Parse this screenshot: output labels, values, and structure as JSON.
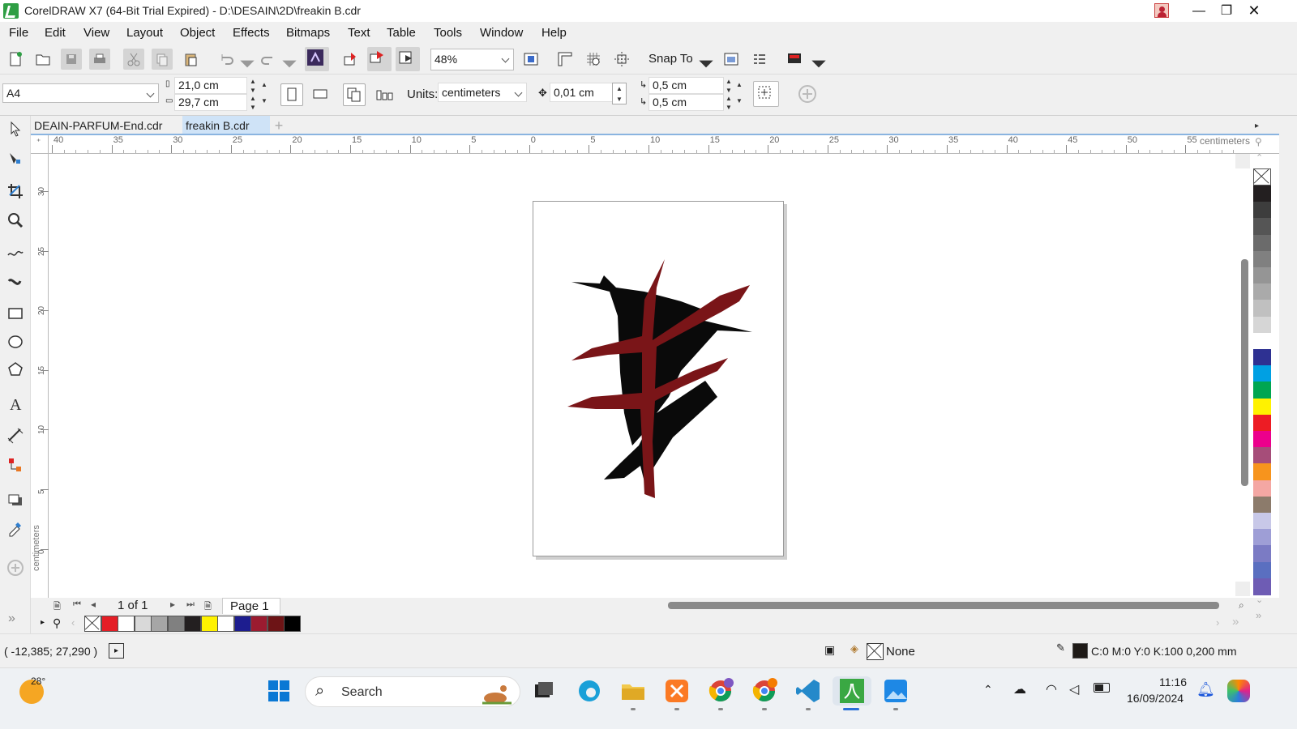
{
  "window": {
    "title": "CorelDRAW X7 (64-Bit Trial Expired) - D:\\DESAIN\\2D\\freakin B.cdr",
    "minimize": "—",
    "maximize": "❐",
    "close": "✕"
  },
  "menu": [
    "File",
    "Edit",
    "View",
    "Layout",
    "Object",
    "Effects",
    "Bitmaps",
    "Text",
    "Table",
    "Tools",
    "Window",
    "Help"
  ],
  "toolbar": {
    "zoom": "48%",
    "snap_to": "Snap To"
  },
  "property_bar": {
    "page_size": "A4",
    "width": "21,0 cm",
    "height": "29,7 cm",
    "units_label": "Units:",
    "units": "centimeters",
    "nudge": "0,01 cm",
    "dup_x": "0,5 cm",
    "dup_y": "0,5 cm"
  },
  "tabs": [
    "DEAIN-PARFUM-End.cdr",
    "freakin B.cdr"
  ],
  "ruler": {
    "h_ticks": [
      "40",
      "35",
      "30",
      "25",
      "20",
      "15",
      "10",
      "5",
      "0",
      "5",
      "10",
      "15",
      "20",
      "25",
      "30",
      "35",
      "40",
      "45",
      "50",
      "55"
    ],
    "h_unit": "centimeters",
    "v_ticks": [
      "30",
      "25",
      "20",
      "15",
      "10",
      "5",
      "0"
    ],
    "v_unit": "centimeters"
  },
  "page_nav": {
    "count": "1 of 1",
    "page_tab": "Page 1"
  },
  "palette_bottom": [
    "none",
    "#e41e26",
    "#ffffff",
    "#d9d9d9",
    "#a6a6a6",
    "#808080",
    "#231f20",
    "#fff200",
    "#ffffff",
    "#1d1d8f",
    "#9b1b30",
    "#6d1416",
    "#000000"
  ],
  "palette_right": [
    "#231f20",
    "#3d3d3d",
    "#555555",
    "#6b6b6b",
    "#808080",
    "#959595",
    "#aaaaaa",
    "#c0c0c0",
    "#d6d6d6",
    "#ffffff",
    "#2e3192",
    "#00a0e3",
    "#00a651",
    "#fff200",
    "#ed1c24",
    "#ec008c",
    "#a64d79",
    "#f7941d",
    "#f4a7a3",
    "#8c7b6b",
    "#c8c8e8",
    "#9e9ed6",
    "#7b7bc4",
    "#5a6fc0",
    "#6e5cb4"
  ],
  "status": {
    "coords": "( -12,385; 27,290 )",
    "fill": "None",
    "outline": "C:0 M:0 Y:0 K:100  0,200 mm"
  },
  "taskbar": {
    "weather": "28°",
    "search": "Search",
    "time": "11:16",
    "date": "16/09/2024"
  }
}
